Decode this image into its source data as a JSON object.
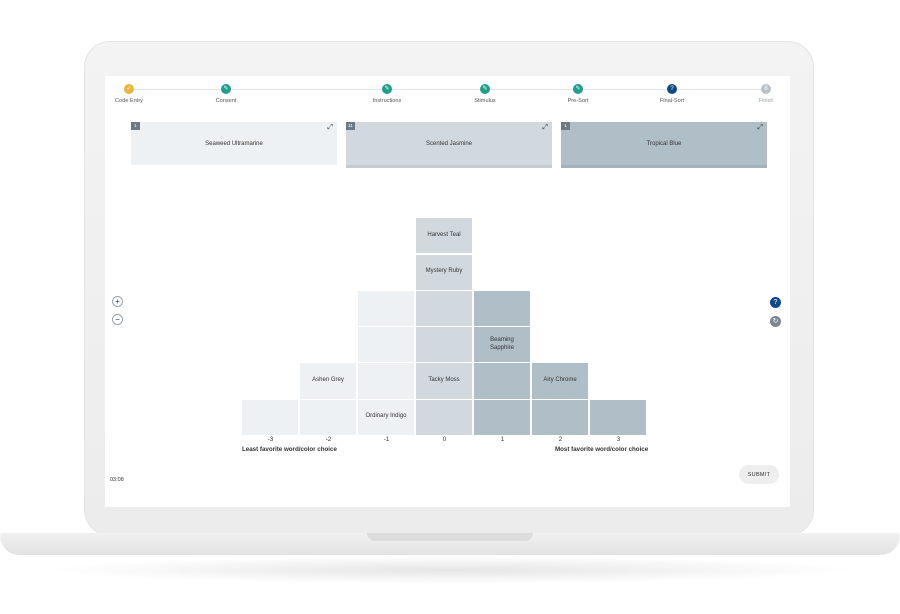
{
  "steps": [
    {
      "label": "Code Entry",
      "state": "first",
      "glyph": "✓"
    },
    {
      "label": "Consent",
      "state": "done",
      "glyph": "✎"
    },
    {
      "label": "Instructions",
      "state": "done",
      "glyph": "✎"
    },
    {
      "label": "Stimulus",
      "state": "done",
      "glyph": "✎"
    },
    {
      "label": "Pre-Sort",
      "state": "done",
      "glyph": "✎"
    },
    {
      "label": "Final-Sort",
      "state": "current",
      "glyph": "?"
    },
    {
      "label": "Finish",
      "state": "future",
      "glyph": "8"
    }
  ],
  "cards": [
    {
      "number": "1",
      "label": "Seaweed Ultramarine",
      "color": "#eef1f3"
    },
    {
      "number": "11",
      "label": "Scented Jasmine",
      "color": "#d2d9de"
    },
    {
      "number": "1",
      "label": "Tropical Blue",
      "color": "#b0bec7"
    }
  ],
  "grid": {
    "columns": [
      "-3",
      "-2",
      "-1",
      "0",
      "1",
      "2",
      "3"
    ],
    "column_heights": [
      1,
      2,
      4,
      6,
      4,
      2,
      1
    ],
    "placed": {
      "-2_1": "Ashen Grey",
      "-1_0": "Ordinary Indigo",
      "0_1": "Tacky Moss",
      "0_4": "Mystery Ruby",
      "0_5": "Harvest Teal",
      "1_2": "Beaming Sapphire",
      "2_1": "Airy Chrome"
    },
    "left_label": "Least favorite word/color choice",
    "right_label": "Most favorite word/color choice"
  },
  "controls": {
    "zoom_in": "+",
    "zoom_out": "−",
    "help": "?",
    "reset": "↻",
    "timer": "03:08",
    "submit": "SUBMIT"
  },
  "colors": {
    "step_done": "#1f9e8a",
    "step_first": "#e8b63a",
    "step_current": "#0f4a87",
    "negative_cells": "#eef1f3",
    "neutral_cells": "#d2d9de",
    "positive_cells": "#b0bec7"
  }
}
